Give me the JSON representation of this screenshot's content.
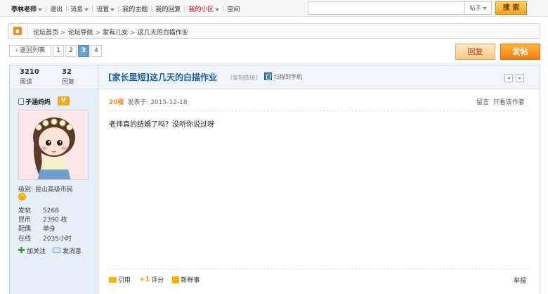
{
  "topbar": {
    "username": "亭林老师",
    "logout": "退出",
    "messages": "消息",
    "settings": "设置",
    "my_topics": "我的主题",
    "my_replies": "我的回复",
    "my_community": "我的小区",
    "space": "空间",
    "search_placeholder": "",
    "search_type": "帖子",
    "search_button": "搜 索"
  },
  "breadcrumb": {
    "items": [
      "论坛首页",
      "论坛导航",
      "家有儿女",
      "这几天的白描作业"
    ],
    "separator": ">"
  },
  "pager": {
    "back_label": "返回列表",
    "pages": [
      "1",
      "2",
      "3",
      "4"
    ],
    "current": "3"
  },
  "buttons": {
    "reply": "回复",
    "post": "发帖"
  },
  "thread": {
    "views": "3210",
    "views_label": "阅读",
    "replies": "32",
    "replies_label": "回复",
    "title": "[家长里短]这几天的白描作业",
    "copy_link": "[复制链接]",
    "scan_mobile": "扫描到手机",
    "prev_arrow": "◂",
    "next_arrow": "▸"
  },
  "author": {
    "name": "子涵妈妈",
    "badge": "V",
    "level_label": "级别:",
    "level_value": "昆山高级市民",
    "stats": [
      {
        "key": "发帖",
        "value": "5268"
      },
      {
        "key": "昆币",
        "value": "2390 枚"
      },
      {
        "key": "配偶",
        "value": "单身"
      },
      {
        "key": "在线",
        "value": "2035小时"
      }
    ],
    "follow": "加关注",
    "send_message": "发消息"
  },
  "post": {
    "floor": "20楼",
    "posted_label": "发表于:",
    "date": "2015-12-18",
    "comment": "留言",
    "only_author": "只看该作者",
    "content": "老师真的结婚了吗？没听你说过呀",
    "quote": "引用",
    "rate": "评分",
    "news": "新鲜事",
    "report": "举报"
  },
  "colors": {
    "accent_orange": "#f08a24",
    "link_blue": "#1a5ea8",
    "sidebar_bg": "#e6eef7",
    "highlight_red": "#d40000"
  }
}
